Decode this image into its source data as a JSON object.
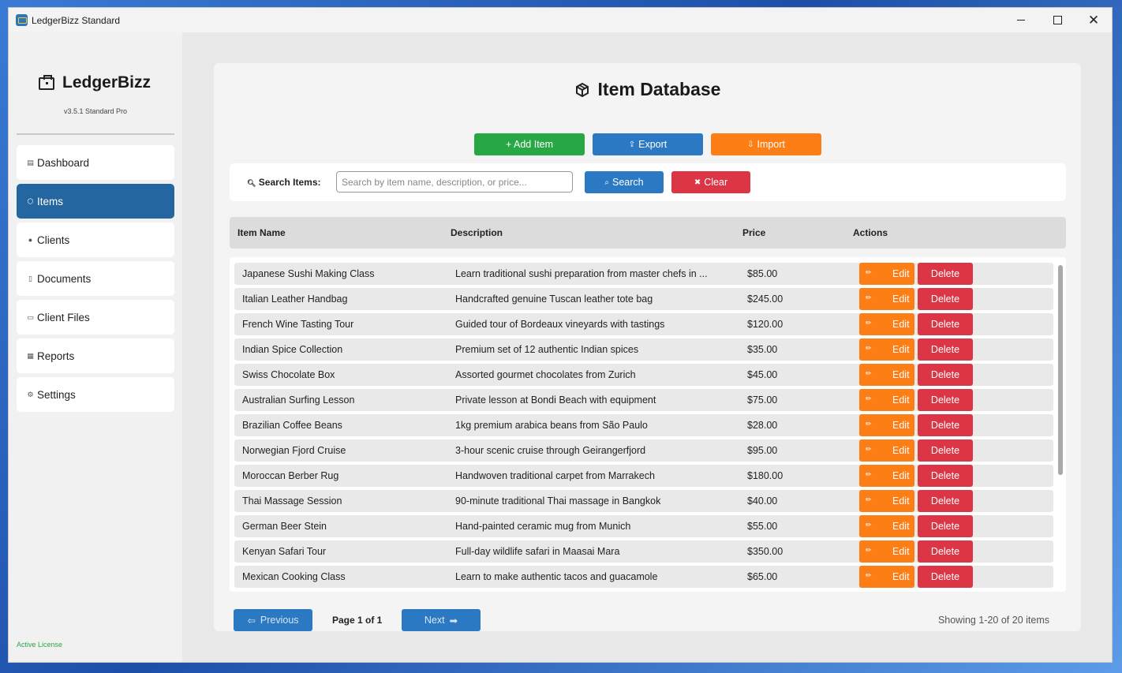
{
  "window": {
    "title": "LedgerBizz Standard"
  },
  "sidebar": {
    "brand": "LedgerBizz",
    "version": "v3.5.1 Standard Pro",
    "items": [
      {
        "label": "Dashboard",
        "icon": "chart-icon",
        "glyph": "▤"
      },
      {
        "label": "Items",
        "icon": "box-icon",
        "glyph": "⬡"
      },
      {
        "label": "Clients",
        "icon": "users-icon",
        "glyph": "●"
      },
      {
        "label": "Documents",
        "icon": "document-icon",
        "glyph": "▯"
      },
      {
        "label": "Client Files",
        "icon": "folder-icon",
        "glyph": "▭"
      },
      {
        "label": "Reports",
        "icon": "report-icon",
        "glyph": "▦"
      },
      {
        "label": "Settings",
        "icon": "gear-icon",
        "glyph": "⚙"
      }
    ],
    "active_index": 1,
    "license": "Active License"
  },
  "main": {
    "title": "Item Database",
    "actions": {
      "add": "+ Add Item",
      "export": "Export",
      "import": "Import"
    },
    "search": {
      "label": "Search Items:",
      "placeholder": "Search by item name, description, or price...",
      "value": "",
      "search_button": "Search",
      "clear_button": "Clear"
    },
    "table": {
      "columns": [
        "Item Name",
        "Description",
        "Price",
        "Actions"
      ],
      "rows": [
        {
          "name": "Japanese Sushi Making Class",
          "description": "Learn traditional sushi preparation from master chefs in ...",
          "price": "$85.00"
        },
        {
          "name": "Italian Leather Handbag",
          "description": "Handcrafted genuine Tuscan leather tote bag",
          "price": "$245.00"
        },
        {
          "name": "French Wine Tasting Tour",
          "description": "Guided tour of Bordeaux vineyards with tastings",
          "price": "$120.00"
        },
        {
          "name": "Indian Spice Collection",
          "description": "Premium set of 12 authentic Indian spices",
          "price": "$35.00"
        },
        {
          "name": "Swiss Chocolate Box",
          "description": "Assorted gourmet chocolates from Zurich",
          "price": "$45.00"
        },
        {
          "name": "Australian Surfing Lesson",
          "description": "Private lesson at Bondi Beach with equipment",
          "price": "$75.00"
        },
        {
          "name": "Brazilian Coffee Beans",
          "description": "1kg premium arabica beans from São Paulo",
          "price": "$28.00"
        },
        {
          "name": "Norwegian Fjord Cruise",
          "description": "3-hour scenic cruise through Geirangerfjord",
          "price": "$95.00"
        },
        {
          "name": "Moroccan Berber Rug",
          "description": "Handwoven traditional carpet from Marrakech",
          "price": "$180.00"
        },
        {
          "name": "Thai Massage Session",
          "description": "90-minute traditional Thai massage in Bangkok",
          "price": "$40.00"
        },
        {
          "name": "German Beer Stein",
          "description": "Hand-painted ceramic mug from Munich",
          "price": "$55.00"
        },
        {
          "name": "Kenyan Safari Tour",
          "description": "Full-day wildlife safari in Maasai Mara",
          "price": "$350.00"
        },
        {
          "name": "Mexican Cooking Class",
          "description": "Learn to make authentic tacos and guacamole",
          "price": "$65.00"
        }
      ],
      "edit_label": "Edit",
      "delete_label": "Delete"
    },
    "pagination": {
      "previous": "Previous",
      "next": "Next",
      "page_prefix": "Page ",
      "page_current": "1 of 1",
      "showing": "Showing 1-20 of 20 items"
    }
  },
  "colors": {
    "accent_blue": "#2b79c2",
    "active_nav": "#2366a0",
    "success": "#28a745",
    "warning": "#fd7e14",
    "danger": "#dc3545"
  }
}
